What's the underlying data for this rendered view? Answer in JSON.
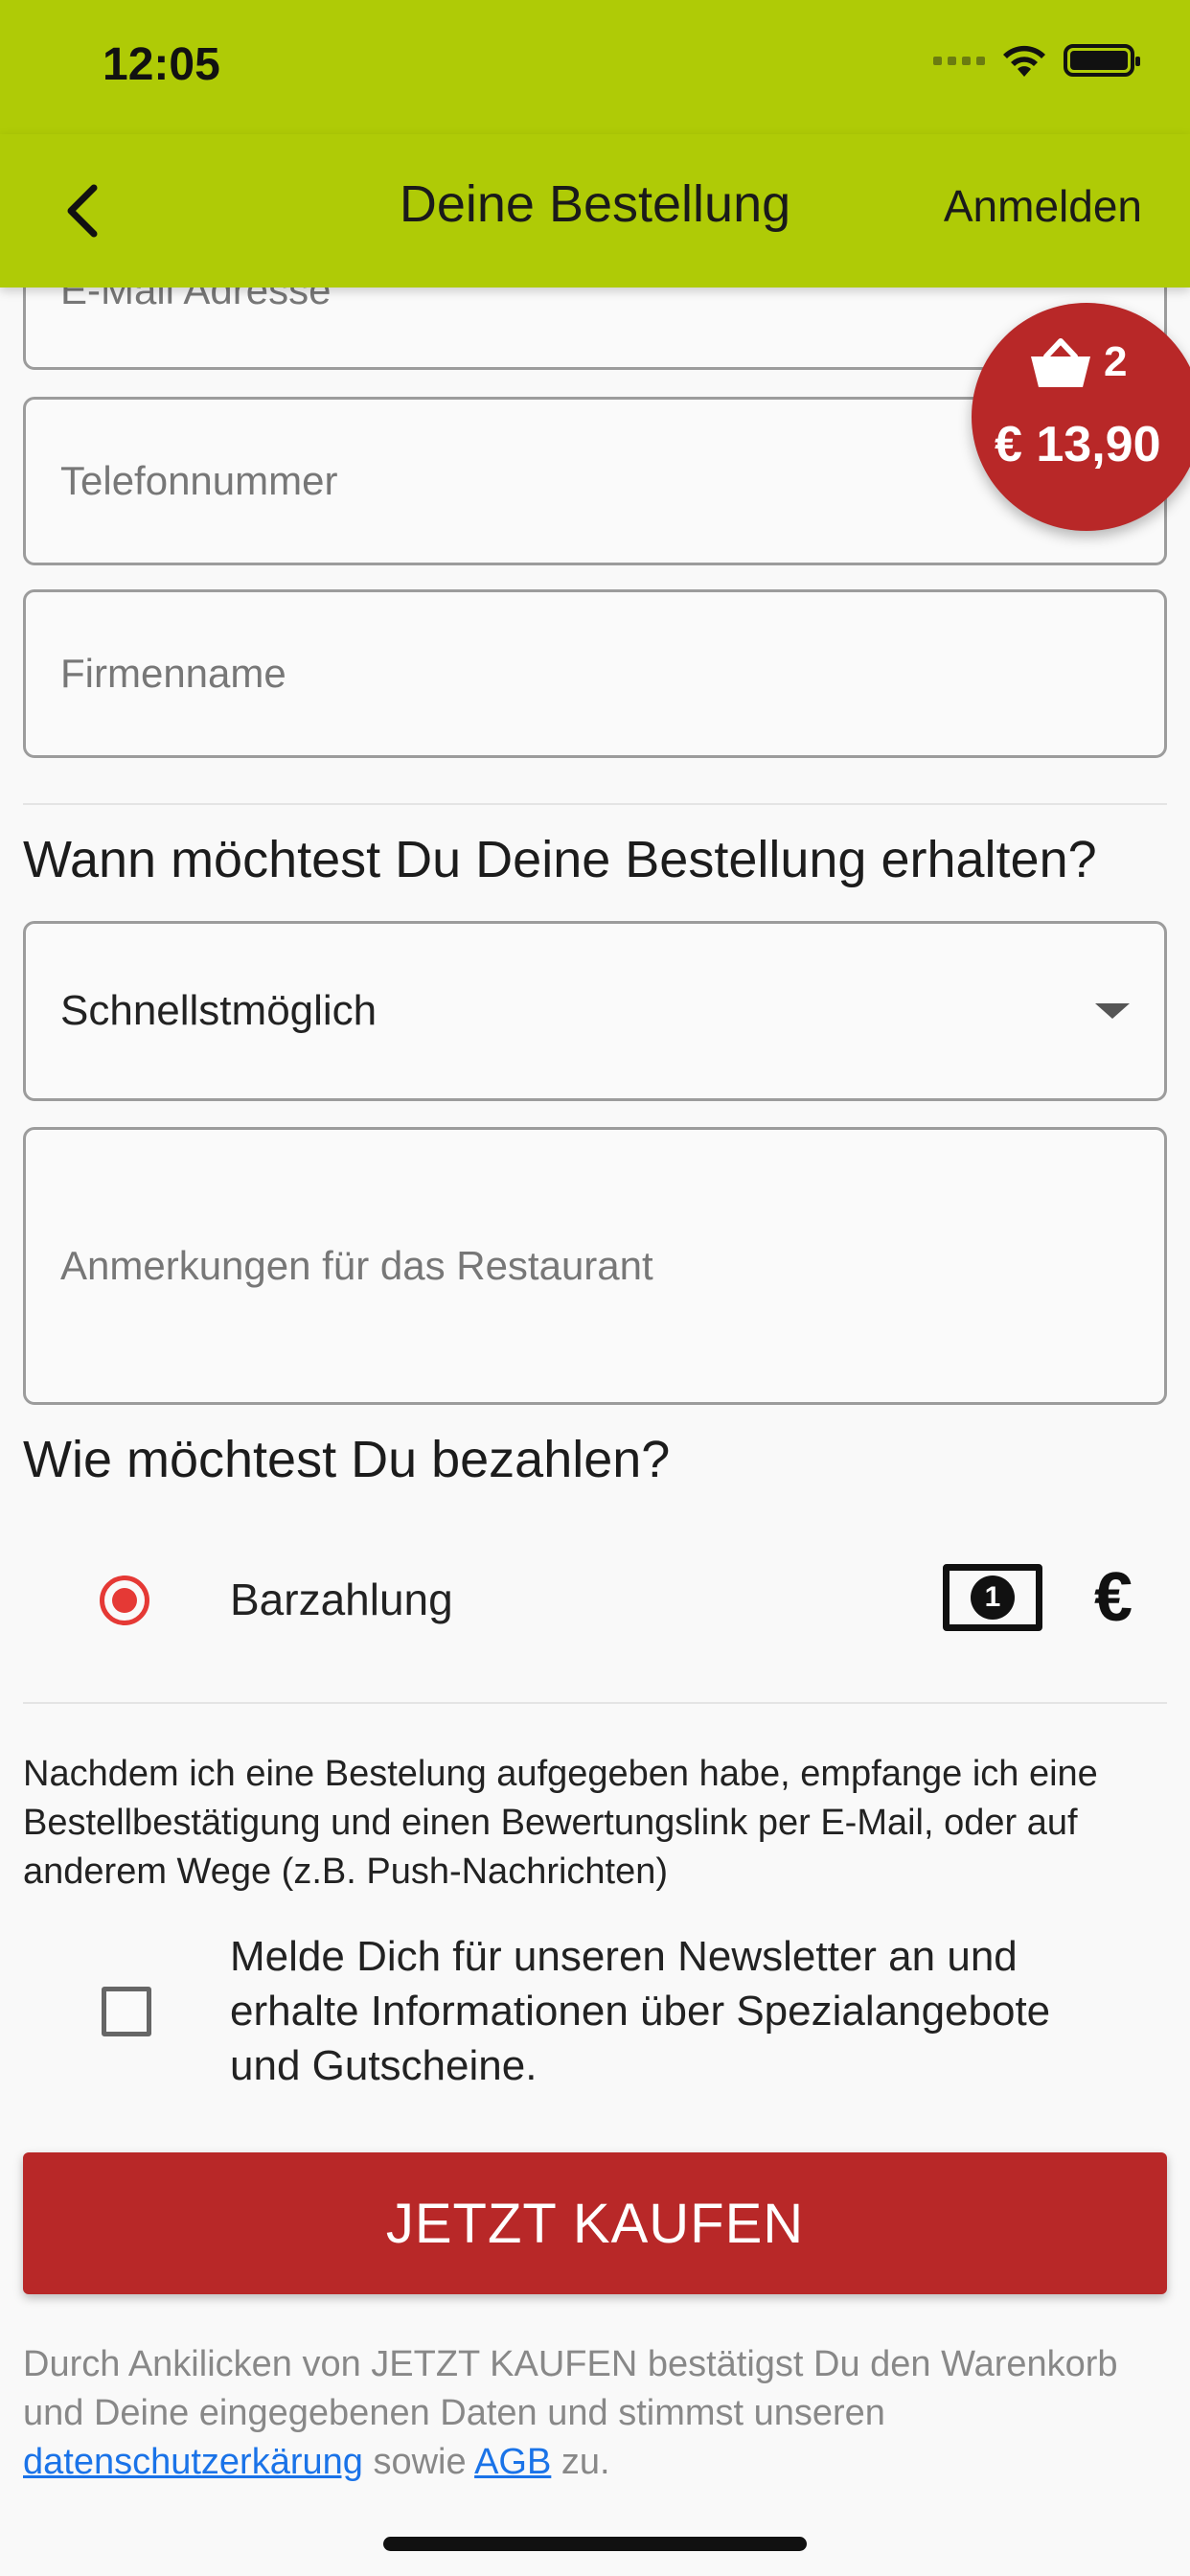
{
  "status_bar": {
    "time": "12:05"
  },
  "nav": {
    "title": "Deine Bestellung",
    "login": "Anmelden"
  },
  "cart": {
    "count": "2",
    "total": "€ 13,90"
  },
  "form": {
    "email_placeholder": "E-Mail Adresse",
    "phone_placeholder": "Telefonnummer",
    "company_placeholder": "Firmenname",
    "delivery_heading": "Wann möchtest Du Deine Bestellung erhalten?",
    "delivery_selected": "Schnellstmöglich",
    "notes_placeholder": "Anmerkungen für das Restaurant"
  },
  "payment": {
    "heading": "Wie möchtest Du bezahlen?",
    "option_label": "Barzahlung",
    "selected": true,
    "cash_icon_glyph": "1",
    "currency_symbol": "€"
  },
  "info_text": "Nachdem ich eine Bestelung aufgegeben habe, empfange ich eine Bestellbestätigung und einen Bewertungslink per E-Mail, oder auf anderem Wege (z.B. Push-Nachrichten)",
  "newsletter": {
    "label": "Melde Dich für unseren Newsletter an und erhalte Informationen über Spezialangebote und Gutscheine.",
    "checked": false
  },
  "buy_button": "JETZT KAUFEN",
  "legal": {
    "prefix": "Durch Ankilicken von JETZT KAUFEN bestätigst Du den Warenkorb und Deine eingegebenen Daten und stimmst unseren ",
    "privacy_link": "datenschutzerkärung",
    "middle": " sowie ",
    "terms_link": "AGB",
    "suffix": " zu."
  },
  "colors": {
    "header_green": "#afcb06",
    "brand_red": "#b82828",
    "radio_red": "#e53935",
    "link_blue": "#1a73e8"
  }
}
